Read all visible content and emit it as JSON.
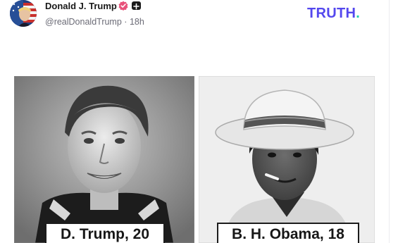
{
  "post": {
    "author_name": "Donald J. Trump",
    "handle": "@realDonaldTrump",
    "separator": "·",
    "time_ago": "18h"
  },
  "brand": {
    "logo_text": "TRUTH",
    "logo_dot": ".",
    "logo_color": "#5448ee",
    "dot_color": "#1fd0ad"
  },
  "media": {
    "left_caption": "D. Trump, 20",
    "right_caption": "B. H. Obama, 18"
  },
  "icons": {
    "verified": "verified-badge-icon",
    "plus": "plus-badge-icon"
  }
}
